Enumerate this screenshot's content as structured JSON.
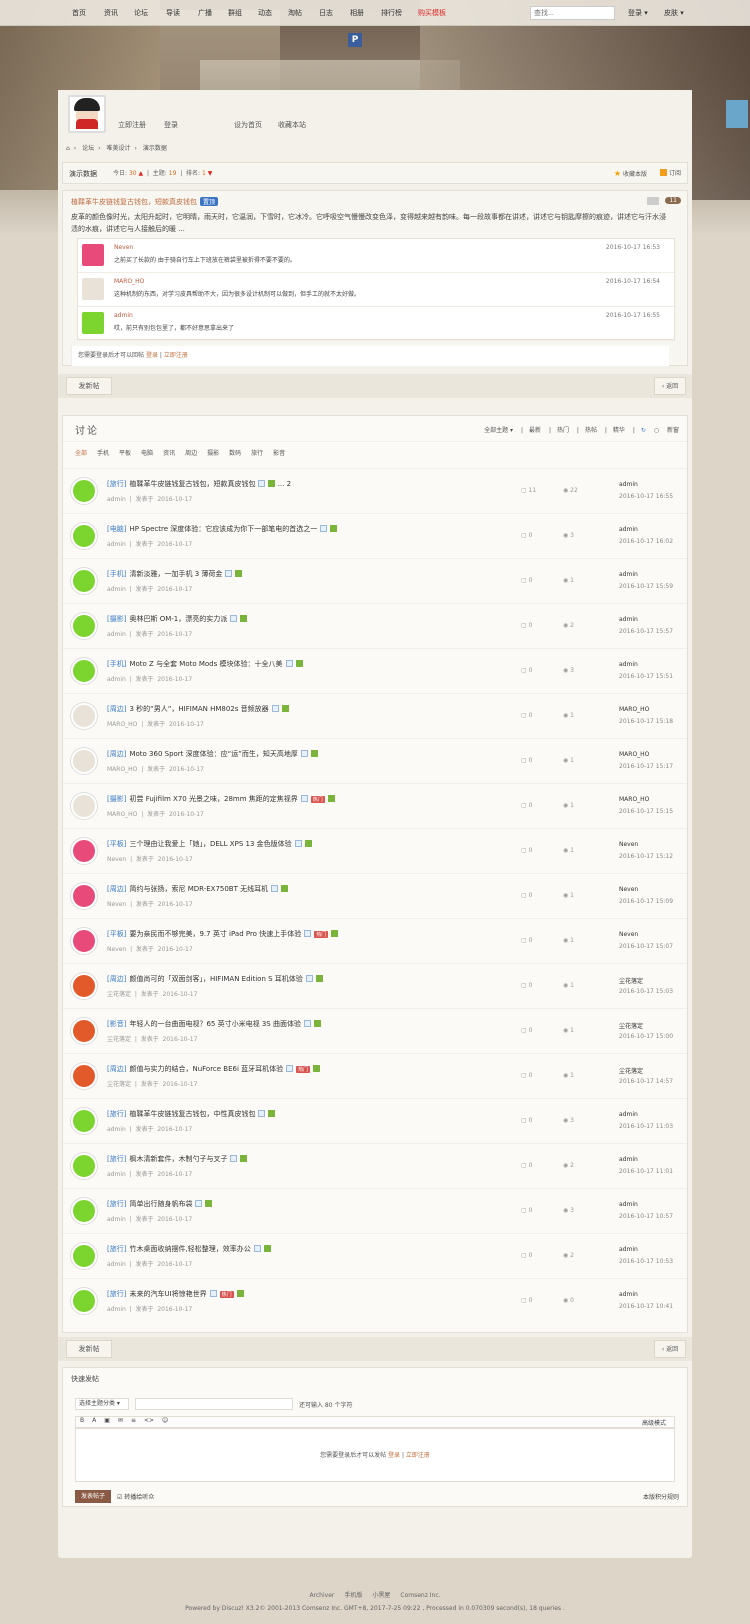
{
  "topnav": {
    "items": [
      "首页",
      "资讯",
      "论坛",
      "导读",
      "广播",
      "群组",
      "动态",
      "淘帖",
      "日志",
      "相册",
      "排行榜",
      "购买模板"
    ],
    "search_placeholder": "查找...",
    "login": "登录",
    "skin": "皮肤"
  },
  "profile": {
    "register": "立即注册",
    "login": "登录",
    "set_home": "设为首页",
    "bookmark": "收藏本站"
  },
  "breadcrumb": [
    "论坛",
    "唯美设计",
    "演示数据"
  ],
  "forum": {
    "name": "演示数据",
    "today_label": "今日:",
    "today_value": "30",
    "topics_label": "主题:",
    "topics_value": "19",
    "rank_label": "排名:",
    "rank_value": "1",
    "favorite": "收藏本版",
    "subscribe": "订阅"
  },
  "sticky": {
    "title": "植鞣革牛皮链钱复古钱包，短款真皮钱包",
    "tag": "置顶",
    "reply_count": "11",
    "body": "皮革的颜色像时光，太阳升起时，它明晴，雨天时，它温润，下雪时，它冰冷。它呼吸空气慢慢改变色泽，变得越来越有韵味。每一段故事都在讲述，讲述它与钥匙摩擦的痕迹，讲述它与汗水浸渍的水痕，讲述它与人接触后的暖 ...",
    "comments": [
      {
        "name": "Neven",
        "text": "之前买了长款的 由于骑自行车上下班放在裤袋里被折得不要不要的。",
        "time": "2016-10-17 16:53"
      },
      {
        "name": "MARO_HO",
        "text": "这种机制的东西，对学习皮具帮助不大，因为很多设计机制可以做到，但手工的就不太好做。",
        "time": "2016-10-17 16:54"
      },
      {
        "name": "admin",
        "text": "哎，前只有别包包里了，都不好意思拿出来了",
        "time": "2016-10-17 16:55"
      }
    ],
    "need_login": "您需要登录后才可以回帖",
    "login": "登录",
    "sep": "|",
    "register": "立即注册"
  },
  "actions": {
    "new_post": "发新帖",
    "back": "返回"
  },
  "list": {
    "title": "讨论",
    "options": [
      "全部主题",
      "最新",
      "热门",
      "热帖",
      "精华",
      "新窗"
    ],
    "categories": [
      "全部",
      "手机",
      "平板",
      "电脑",
      "资讯",
      "周边",
      "摄影",
      "数码",
      "旅行",
      "影音"
    ],
    "threads": [
      {
        "cat": "[旅行]",
        "title": "植鞣革牛皮链钱复古钱包，短款真皮钱包",
        "extra": "... 2",
        "author": "admin",
        "date": "2016-10-17",
        "replies": "11",
        "views": "22",
        "last": "admin",
        "last_time": "2016-10-17 16:55",
        "hot": false
      },
      {
        "cat": "[电脑]",
        "title": "HP Spectre 深度体验：它应该成为你下一部笔电的首选之一",
        "extra": "",
        "author": "admin",
        "date": "2016-10-17",
        "replies": "0",
        "views": "3",
        "last": "admin",
        "last_time": "2016-10-17 16:02",
        "hot": false
      },
      {
        "cat": "[手机]",
        "title": "清新淡雅，一加手机 3 薄荷金",
        "extra": "",
        "author": "admin",
        "date": "2016-10-17",
        "replies": "0",
        "views": "1",
        "last": "admin",
        "last_time": "2016-10-17 15:59",
        "hot": false
      },
      {
        "cat": "[摄影]",
        "title": "奥林巴斯 OM-1，漂亮的实力派",
        "extra": "",
        "author": "admin",
        "date": "2016-10-17",
        "replies": "0",
        "views": "2",
        "last": "admin",
        "last_time": "2016-10-17 15:57",
        "hot": false
      },
      {
        "cat": "[手机]",
        "title": "Moto Z 与全套 Moto Mods 模块体验：十全八美",
        "extra": "",
        "author": "admin",
        "date": "2016-10-17",
        "replies": "0",
        "views": "3",
        "last": "admin",
        "last_time": "2016-10-17 15:51",
        "hot": false
      },
      {
        "cat": "[周边]",
        "title": "3 秒的“男人”，HIFIMAN HM802s 音频放器",
        "extra": "",
        "author": "MARO_HO",
        "date": "2016-10-17",
        "replies": "0",
        "views": "1",
        "last": "MARO_HO",
        "last_time": "2016-10-17 15:18",
        "hot": false
      },
      {
        "cat": "[周边]",
        "title": "Moto 360 Sport 深度体验：应“运”而生，知天高地厚",
        "extra": "",
        "author": "MARO_HO",
        "date": "2016-10-17",
        "replies": "0",
        "views": "1",
        "last": "MARO_HO",
        "last_time": "2016-10-17 15:17",
        "hot": false
      },
      {
        "cat": "[摄影]",
        "title": "初尝 Fujifilm X70 光景之味，28mm 焦距的定焦视界",
        "extra": "",
        "author": "MARO_HO",
        "date": "2016-10-17",
        "replies": "0",
        "views": "1",
        "last": "MARO_HO",
        "last_time": "2016-10-17 15:15",
        "hot": true
      },
      {
        "cat": "[平板]",
        "title": "三个理由让我爱上「她」，DELL XPS 13 金色版体验",
        "extra": "",
        "author": "Neven",
        "date": "2016-10-17",
        "replies": "0",
        "views": "1",
        "last": "Neven",
        "last_time": "2016-10-17 15:12",
        "hot": false
      },
      {
        "cat": "[周边]",
        "title": "简约与张扬，索尼 MDR-EX750BT 无线耳机",
        "extra": "",
        "author": "Neven",
        "date": "2016-10-17",
        "replies": "0",
        "views": "1",
        "last": "Neven",
        "last_time": "2016-10-17 15:09",
        "hot": false
      },
      {
        "cat": "[平板]",
        "title": "要为亲民而不够完美，9.7 英寸 iPad Pro 快速上手体验",
        "extra": "",
        "author": "Neven",
        "date": "2016-10-17",
        "replies": "0",
        "views": "1",
        "last": "Neven",
        "last_time": "2016-10-17 15:07",
        "hot": true
      },
      {
        "cat": "[周边]",
        "title": "颜值尚可的「双面剑客」，HIFIMAN Edition S 耳机体验",
        "extra": "",
        "author": "尘花落定",
        "date": "2016-10-17",
        "replies": "0",
        "views": "1",
        "last": "尘花落定",
        "last_time": "2016-10-17 15:03",
        "hot": false
      },
      {
        "cat": "[影音]",
        "title": "年轻人的一台曲面电视？65 英寸小米电视 3S 曲面体验",
        "extra": "",
        "author": "尘花落定",
        "date": "2016-10-17",
        "replies": "0",
        "views": "1",
        "last": "尘花落定",
        "last_time": "2016-10-17 15:00",
        "hot": false
      },
      {
        "cat": "[周边]",
        "title": "颜值与实力的结合，NuForce BE6i 蓝牙耳机体验",
        "extra": "",
        "author": "尘花落定",
        "date": "2016-10-17",
        "replies": "0",
        "views": "1",
        "last": "尘花落定",
        "last_time": "2016-10-17 14:57",
        "hot": true
      },
      {
        "cat": "[旅行]",
        "title": "植鞣革牛皮链钱复古钱包，中性真皮钱包",
        "extra": "",
        "author": "admin",
        "date": "2016-10-17",
        "replies": "0",
        "views": "3",
        "last": "admin",
        "last_time": "2016-10-17 11:03",
        "hot": false
      },
      {
        "cat": "[旅行]",
        "title": "枫木清新套件，木制勺子与叉子",
        "extra": "",
        "author": "admin",
        "date": "2016-10-17",
        "replies": "0",
        "views": "2",
        "last": "admin",
        "last_time": "2016-10-17 11:01",
        "hot": false
      },
      {
        "cat": "[旅行]",
        "title": "简单出行随身帆布袋",
        "extra": "",
        "author": "admin",
        "date": "2016-10-17",
        "replies": "0",
        "views": "3",
        "last": "admin",
        "last_time": "2016-10-17 10:57",
        "hot": false
      },
      {
        "cat": "[旅行]",
        "title": "竹木桌面收纳摆件,轻松整理，效率办公",
        "extra": "",
        "author": "admin",
        "date": "2016-10-17",
        "replies": "0",
        "views": "2",
        "last": "admin",
        "last_time": "2016-10-17 10:53",
        "hot": false
      },
      {
        "cat": "[旅行]",
        "title": "未来的汽车UI将惊艳世界",
        "extra": "",
        "author": "admin",
        "date": "2016-10-17",
        "replies": "0",
        "views": "0",
        "last": "admin",
        "last_time": "2016-10-17 10:41",
        "hot": true
      }
    ],
    "sep": "|",
    "posted_in": "发表于",
    "hot_label": "热门"
  },
  "fastpost": {
    "title": "快速发帖",
    "category_select": "选择主题分类",
    "char_tip": "还可输入 80 个字符",
    "toolbar": [
      "B",
      "A",
      "▣",
      "✉",
      "≡",
      "<>",
      "☺"
    ],
    "advanced": "高级模式",
    "need_login": "您需要登录后才可以发帖",
    "login": "登录",
    "sep": "|",
    "register": "立即注册",
    "submit": "发表帖子",
    "notify": "转播给听众",
    "rules": "本版积分规则"
  },
  "footer": {
    "links": [
      "Archiver",
      "手机版",
      "小黑屋",
      "Comsenz Inc."
    ],
    "copyright": "Powered by Discuz! X3.2© 2001-2013 Comsenz Inc. GMT+8, 2017-7-25 09:22 , Processed in 0.070309 second(s), 18 queries ."
  },
  "colors": {
    "accent": "#c06b3e",
    "category_blue": "#3a7bc8",
    "hot_red": "#e02525",
    "page_bg": "#dcd5c8"
  },
  "avatar_colors": {
    "admin": "#7cd42e",
    "MARO_HO": "#e8e2d8",
    "Neven": "#e84a7a",
    "尘花落定": "#e35a2a"
  }
}
